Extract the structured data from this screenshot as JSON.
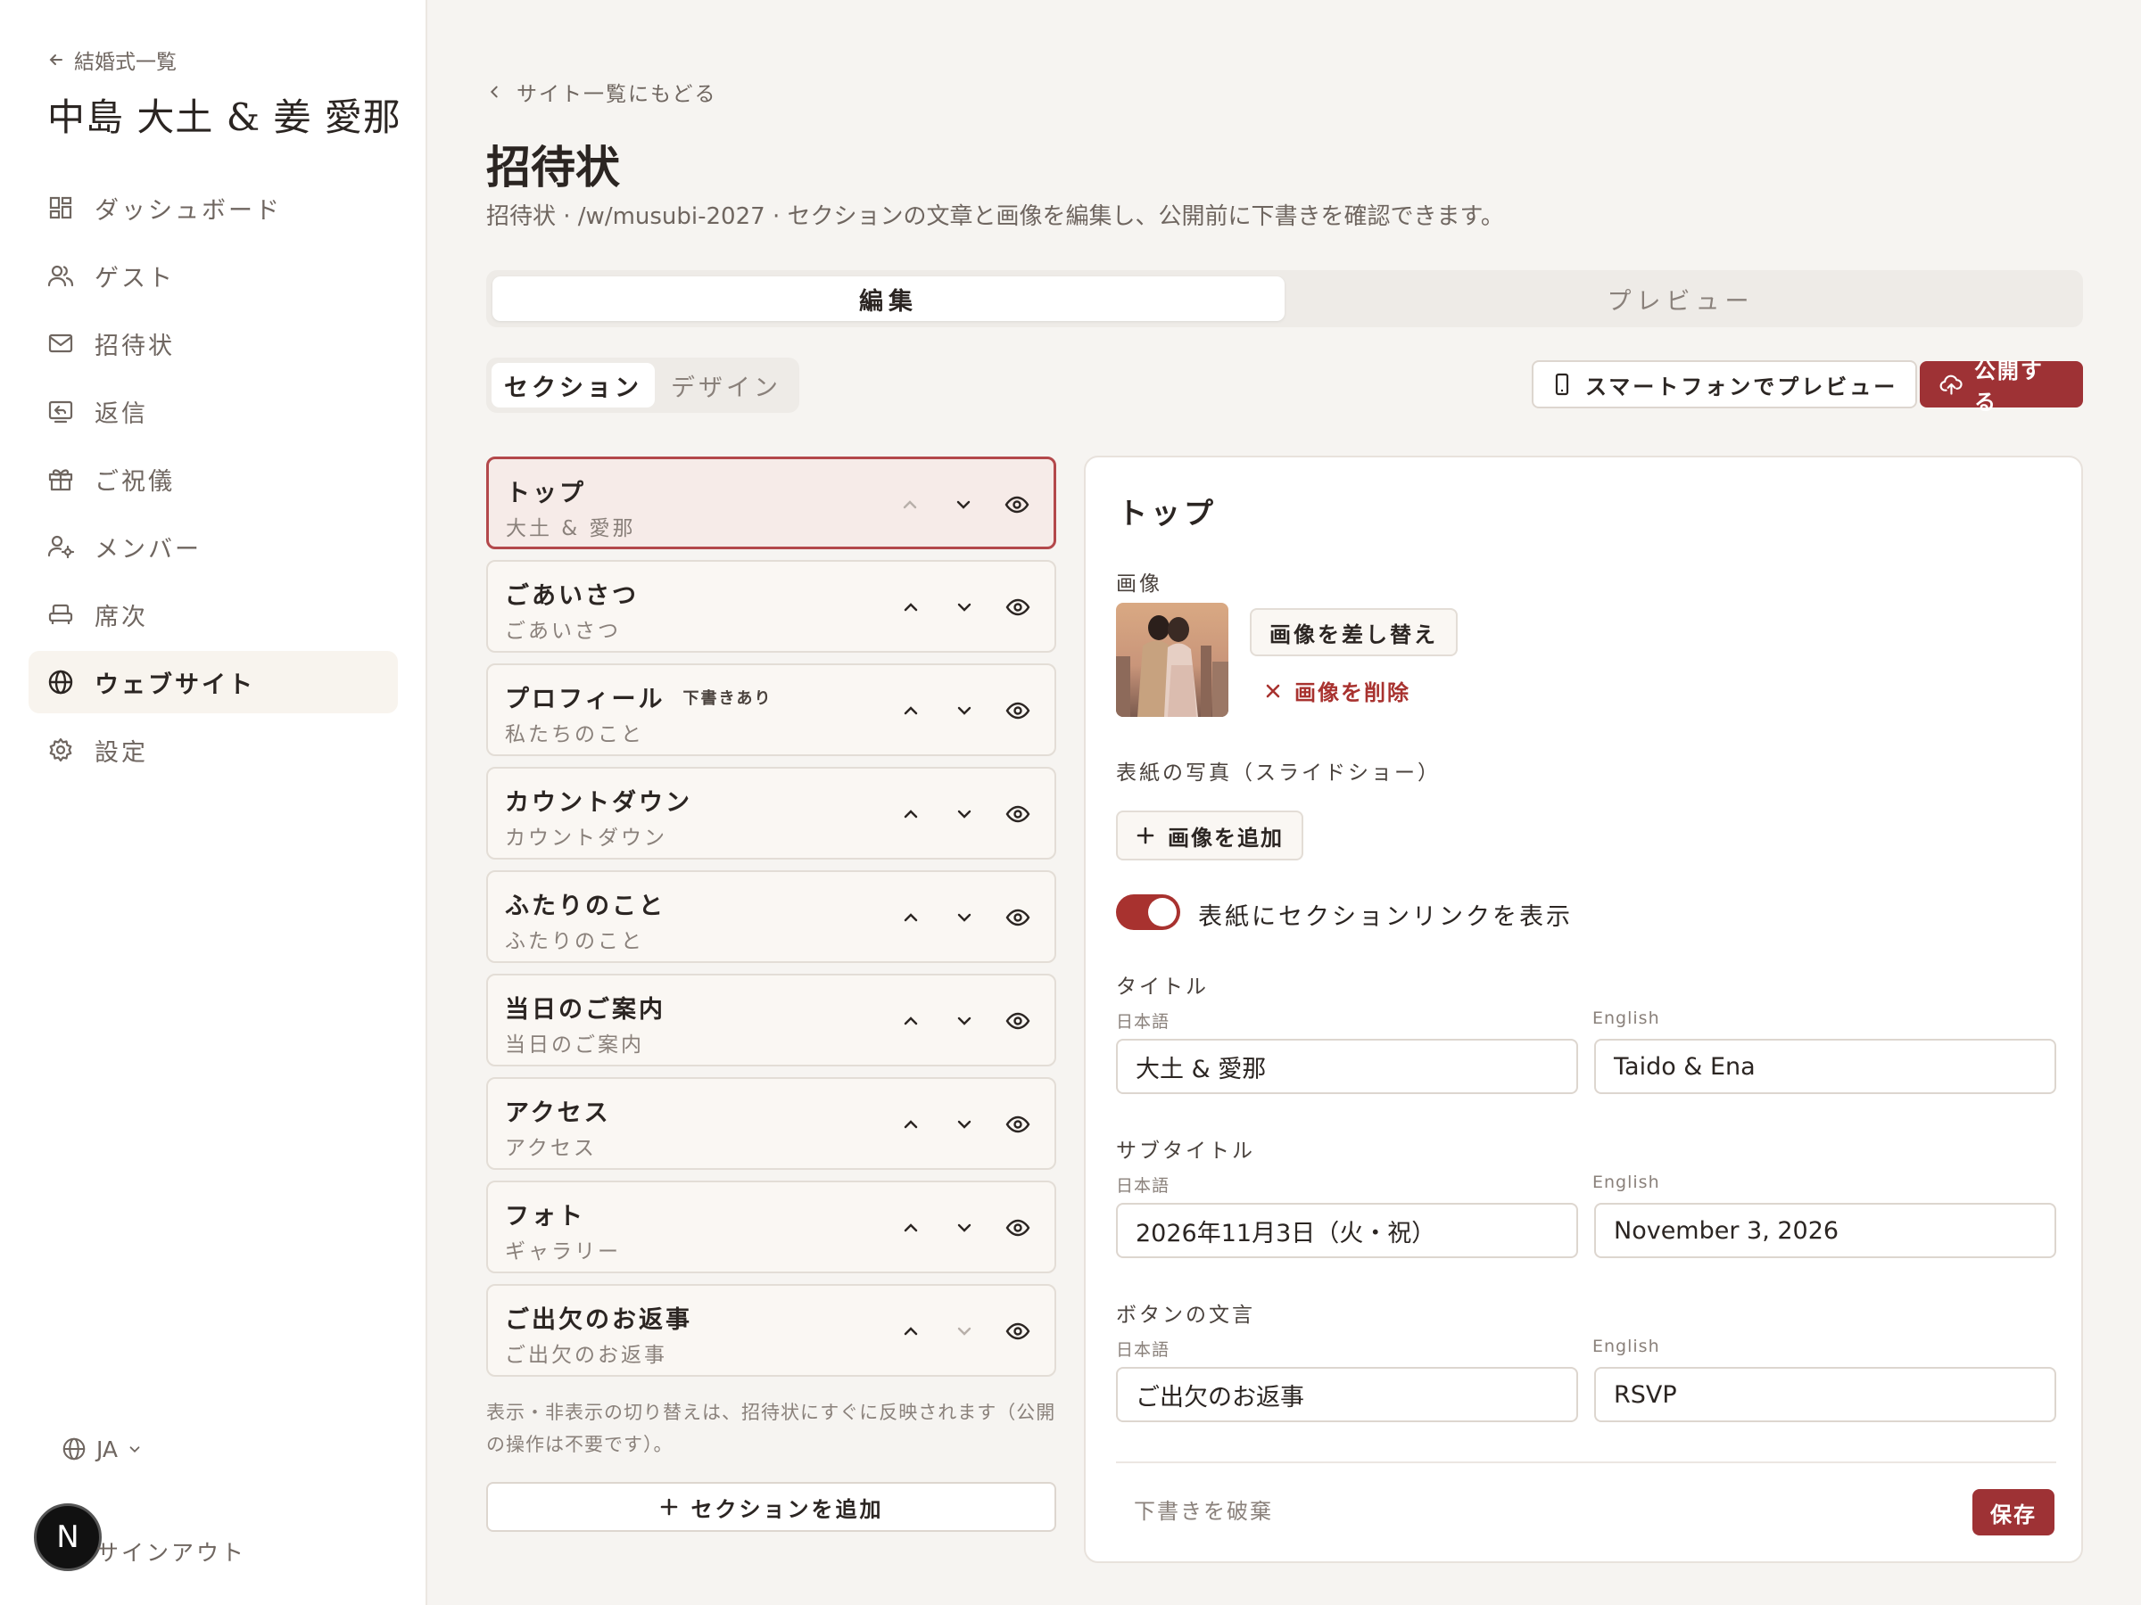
{
  "sidebar": {
    "back_label": "結婚式一覧",
    "couple_name": "中島 大土 & 姜 愛那",
    "nav": [
      {
        "label": "ダッシュボード",
        "icon": "dashboard-icon"
      },
      {
        "label": "ゲスト",
        "icon": "users-icon"
      },
      {
        "label": "招待状",
        "icon": "mail-icon"
      },
      {
        "label": "返信",
        "icon": "reply-icon"
      },
      {
        "label": "ご祝儀",
        "icon": "gift-icon"
      },
      {
        "label": "メンバー",
        "icon": "member-icon"
      },
      {
        "label": "席次",
        "icon": "seat-icon"
      },
      {
        "label": "ウェブサイト",
        "icon": "globe-icon",
        "active": true
      },
      {
        "label": "設定",
        "icon": "gear-icon"
      }
    ],
    "language": "JA",
    "avatar_letter": "N",
    "signout_label": "サインアウト"
  },
  "header": {
    "back_label": "サイト一覧にもどる",
    "title": "招待状",
    "description": "招待状 · /w/musubi-2027 · セクションの文章と画像を編集し、公開前に下書きを確認できます。"
  },
  "main_tabs": [
    {
      "label": "編集",
      "active": true
    },
    {
      "label": "プレビュー",
      "active": false
    }
  ],
  "sub_tabs": [
    {
      "label": "セクション",
      "active": true
    },
    {
      "label": "デザイン",
      "active": false
    }
  ],
  "toolbar": {
    "preview_label": "スマートフォンでプレビュー",
    "publish_label": "公開する"
  },
  "sections": [
    {
      "name": "トップ",
      "sub": "大土 & 愛那",
      "selected": true,
      "badge": ""
    },
    {
      "name": "ごあいさつ",
      "sub": "ごあいさつ",
      "badge": ""
    },
    {
      "name": "プロフィール",
      "sub": "私たちのこと",
      "badge": "下書きあり"
    },
    {
      "name": "カウントダウン",
      "sub": "カウントダウン",
      "badge": ""
    },
    {
      "name": "ふたりのこと",
      "sub": "ふたりのこと",
      "badge": ""
    },
    {
      "name": "当日のご案内",
      "sub": "当日のご案内",
      "badge": ""
    },
    {
      "name": "アクセス",
      "sub": "アクセス",
      "badge": ""
    },
    {
      "name": "フォト",
      "sub": "ギャラリー",
      "badge": ""
    },
    {
      "name": "ご出欠のお返事",
      "sub": "ご出欠のお返事",
      "badge": ""
    }
  ],
  "list_note": "表示・非表示の切り替えは、招待状にすぐに反映されます（公開の操作は不要です）。",
  "add_section_label": "セクションを追加",
  "editor": {
    "title": "トップ",
    "image_label": "画像",
    "replace_image": "画像を差し替え",
    "delete_image": "画像を削除",
    "slideshow_label": "表紙の写真（スライドショー）",
    "add_image": "画像を追加",
    "toggle_label": "表紙にセクションリンクを表示",
    "toggle_on": true,
    "lang_ja": "日本語",
    "lang_en": "English",
    "title_label": "タイトル",
    "title_ja": "大土 & 愛那",
    "title_en": "Taido & Ena",
    "subtitle_label": "サブタイトル",
    "subtitle_ja": "2026年11月3日（火・祝）",
    "subtitle_en": "November 3, 2026",
    "button_label": "ボタンの文言",
    "button_ja": "ご出欠のお返事",
    "button_en": "RSVP",
    "discard": "下書きを破棄",
    "save": "保存"
  },
  "colors": {
    "accent": "#9e3235",
    "danger_text": "#a8322f",
    "selected_bg": "#f6ebe8",
    "background": "#f6f4f1"
  }
}
